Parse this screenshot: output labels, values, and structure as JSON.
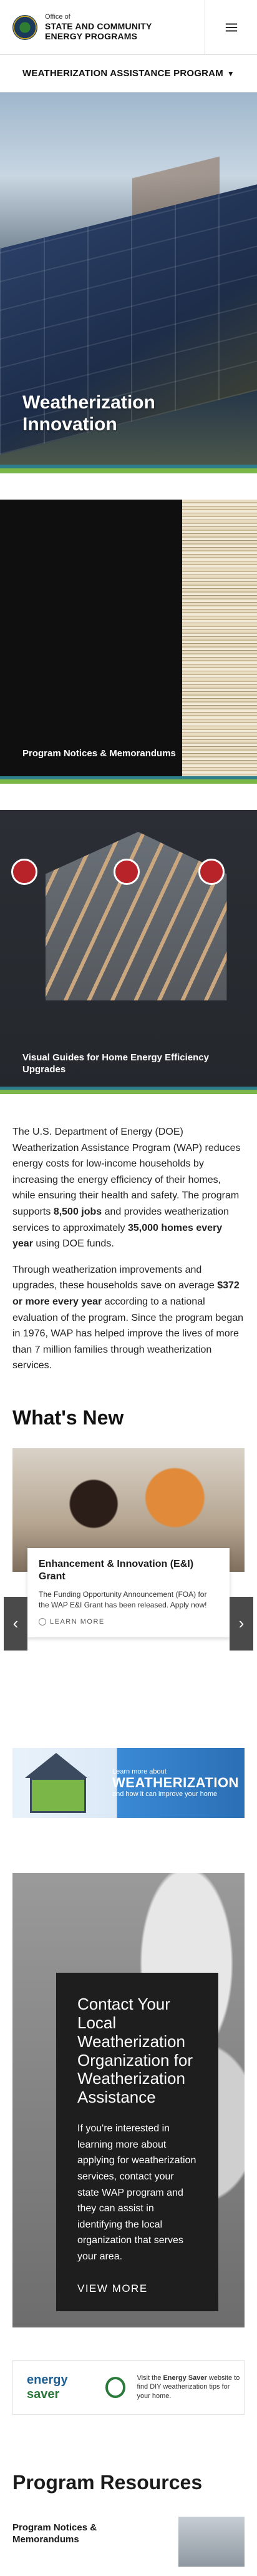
{
  "header": {
    "office_small": "Office of",
    "office_line1": "STATE AND COMMUNITY",
    "office_line2": "ENERGY PROGRAMS",
    "menu_icon": "hamburger-menu-icon"
  },
  "program_nav": {
    "label": "WEATHERIZATION ASSISTANCE PROGRAM",
    "icon": "chevron-down-icon"
  },
  "hero": {
    "title_line1": "Weatherization",
    "title_line2": "Innovation"
  },
  "promos": [
    {
      "label": "Program Notices & Memorandums"
    },
    {
      "label_line1": "Visual Guides for Home Energy Efficiency",
      "label_line2": "Upgrades"
    }
  ],
  "intro": {
    "p1_a": "The U.S. Department of Energy (DOE) Weatherization Assistance Program (WAP) reduces energy costs for low-income households by increasing the energy efficiency of their homes, while ensuring their health and safety. The program supports ",
    "p1_b": "8,500 jobs",
    "p1_c": " and provides weatherization services to approximately ",
    "p1_d": "35,000 homes every year",
    "p1_e": " using DOE funds.",
    "p2_a": "Through weatherization improvements and upgrades, these households save on average ",
    "p2_b": "$372 or more every year",
    "p2_c": " according to a national evaluation of the program. Since the program began in 1976, WAP has helped improve the lives of more than 7 million families through weatherization services."
  },
  "whats_new": {
    "title": "What's New",
    "card_title": "Enhancement & Innovation (E&I) Grant",
    "card_excerpt": "The Funding Opportunity Announcement (FOA) for the WAP E&I Grant has been released. Apply now!",
    "learn_more": "LEARN MORE",
    "prev_icon": "chevron-left-icon",
    "next_icon": "chevron-right-icon"
  },
  "wx_banner": {
    "small_line1": "Learn more about",
    "big": "WEATHERIZATION",
    "small_line2": "and how it can improve your home"
  },
  "contact": {
    "title": "Contact Your Local Weatherization Organization for Weatherization Assistance",
    "body": "If you're interested in learning more about applying for weatherization services, contact your state WAP program and they can assist in identifying the local organization that serves your area.",
    "view_more": "VIEW MORE"
  },
  "energy_saver": {
    "logo_a": "energy",
    "logo_b": "saver",
    "text_a": "Visit the ",
    "text_b": "Energy Saver",
    "text_c": " website to find DIY weatherization tips for your home."
  },
  "resources": {
    "title": "Program Resources",
    "item1_line1": "Program Notices &",
    "item1_line2": "Memorandums"
  },
  "colors": {
    "accent_green": "#7ab648",
    "accent_teal": "#2e7d8a",
    "dark_box": "#1e1e1e"
  }
}
